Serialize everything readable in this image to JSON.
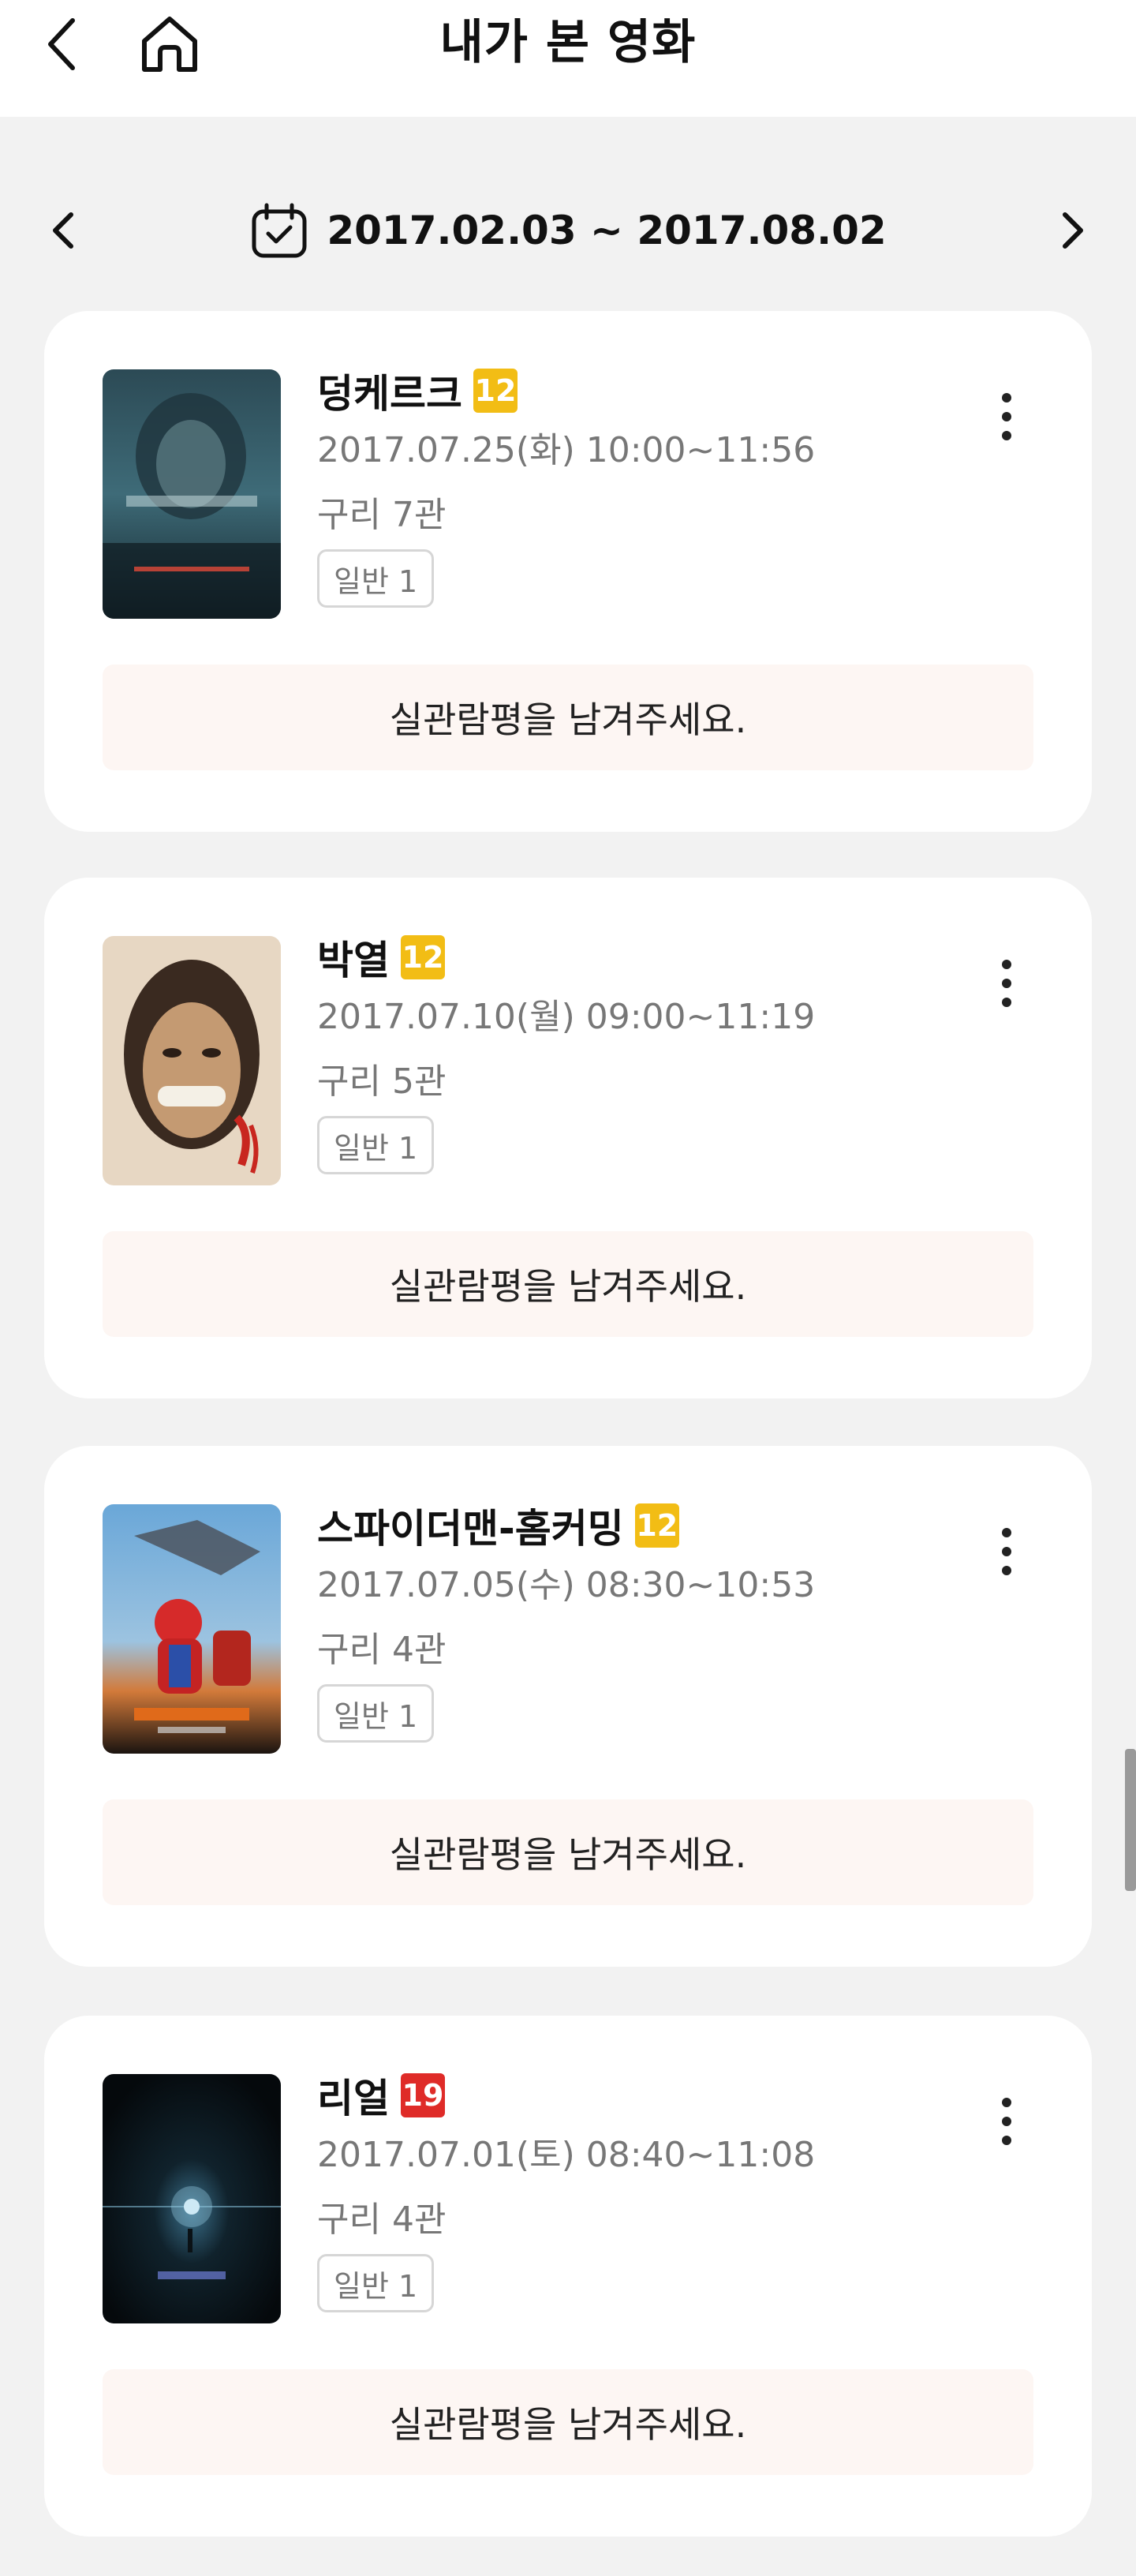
{
  "header": {
    "title": "내가 본 영화"
  },
  "date_range": {
    "text": "2017.02.03 ~ 2017.08.02"
  },
  "accent": {
    "rating_12": "#f2bd15",
    "rating_19": "#df2b28",
    "review_bg": "#fdf6f3"
  },
  "movies": [
    {
      "title": "덩케르크",
      "rating": "12",
      "showtime": "2017.07.25(화) 10:00~11:56",
      "theater": "구리 7관",
      "ticket": "일반 1",
      "review_prompt": "실관람평을 남겨주세요."
    },
    {
      "title": "박열",
      "rating": "12",
      "showtime": "2017.07.10(월) 09:00~11:19",
      "theater": "구리 5관",
      "ticket": "일반 1",
      "review_prompt": "실관람평을 남겨주세요."
    },
    {
      "title": "스파이더맨-홈커밍",
      "rating": "12",
      "showtime": "2017.07.05(수) 08:30~10:53",
      "theater": "구리 4관",
      "ticket": "일반 1",
      "review_prompt": "실관람평을 남겨주세요."
    },
    {
      "title": "리얼",
      "rating": "19",
      "showtime": "2017.07.01(토) 08:40~11:08",
      "theater": "구리 4관",
      "ticket": "일반 1",
      "review_prompt": "실관람평을 남겨주세요."
    }
  ]
}
